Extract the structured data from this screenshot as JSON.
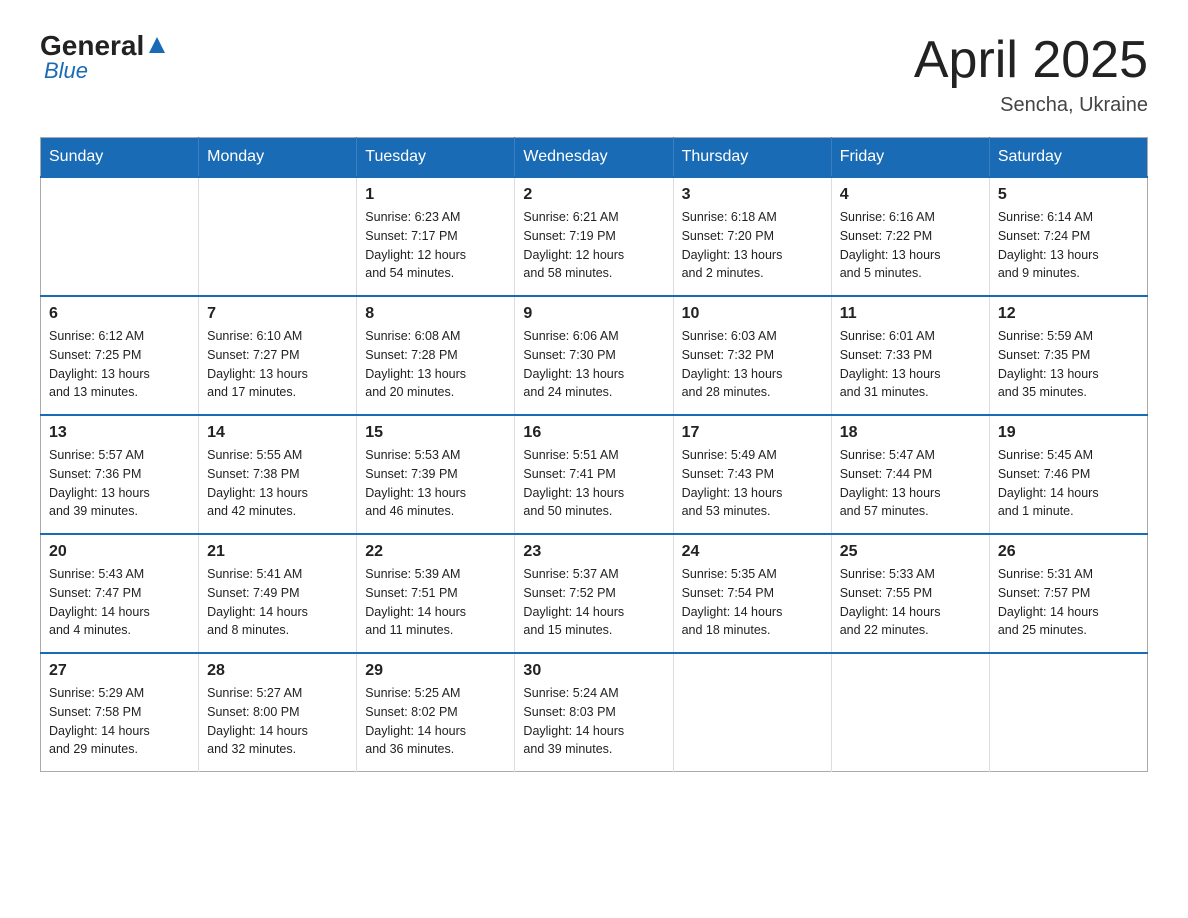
{
  "header": {
    "logo_general": "General",
    "logo_blue": "Blue",
    "title": "April 2025",
    "subtitle": "Sencha, Ukraine"
  },
  "days_of_week": [
    "Sunday",
    "Monday",
    "Tuesday",
    "Wednesday",
    "Thursday",
    "Friday",
    "Saturday"
  ],
  "weeks": [
    [
      {
        "day": "",
        "info": ""
      },
      {
        "day": "",
        "info": ""
      },
      {
        "day": "1",
        "info": "Sunrise: 6:23 AM\nSunset: 7:17 PM\nDaylight: 12 hours\nand 54 minutes."
      },
      {
        "day": "2",
        "info": "Sunrise: 6:21 AM\nSunset: 7:19 PM\nDaylight: 12 hours\nand 58 minutes."
      },
      {
        "day": "3",
        "info": "Sunrise: 6:18 AM\nSunset: 7:20 PM\nDaylight: 13 hours\nand 2 minutes."
      },
      {
        "day": "4",
        "info": "Sunrise: 6:16 AM\nSunset: 7:22 PM\nDaylight: 13 hours\nand 5 minutes."
      },
      {
        "day": "5",
        "info": "Sunrise: 6:14 AM\nSunset: 7:24 PM\nDaylight: 13 hours\nand 9 minutes."
      }
    ],
    [
      {
        "day": "6",
        "info": "Sunrise: 6:12 AM\nSunset: 7:25 PM\nDaylight: 13 hours\nand 13 minutes."
      },
      {
        "day": "7",
        "info": "Sunrise: 6:10 AM\nSunset: 7:27 PM\nDaylight: 13 hours\nand 17 minutes."
      },
      {
        "day": "8",
        "info": "Sunrise: 6:08 AM\nSunset: 7:28 PM\nDaylight: 13 hours\nand 20 minutes."
      },
      {
        "day": "9",
        "info": "Sunrise: 6:06 AM\nSunset: 7:30 PM\nDaylight: 13 hours\nand 24 minutes."
      },
      {
        "day": "10",
        "info": "Sunrise: 6:03 AM\nSunset: 7:32 PM\nDaylight: 13 hours\nand 28 minutes."
      },
      {
        "day": "11",
        "info": "Sunrise: 6:01 AM\nSunset: 7:33 PM\nDaylight: 13 hours\nand 31 minutes."
      },
      {
        "day": "12",
        "info": "Sunrise: 5:59 AM\nSunset: 7:35 PM\nDaylight: 13 hours\nand 35 minutes."
      }
    ],
    [
      {
        "day": "13",
        "info": "Sunrise: 5:57 AM\nSunset: 7:36 PM\nDaylight: 13 hours\nand 39 minutes."
      },
      {
        "day": "14",
        "info": "Sunrise: 5:55 AM\nSunset: 7:38 PM\nDaylight: 13 hours\nand 42 minutes."
      },
      {
        "day": "15",
        "info": "Sunrise: 5:53 AM\nSunset: 7:39 PM\nDaylight: 13 hours\nand 46 minutes."
      },
      {
        "day": "16",
        "info": "Sunrise: 5:51 AM\nSunset: 7:41 PM\nDaylight: 13 hours\nand 50 minutes."
      },
      {
        "day": "17",
        "info": "Sunrise: 5:49 AM\nSunset: 7:43 PM\nDaylight: 13 hours\nand 53 minutes."
      },
      {
        "day": "18",
        "info": "Sunrise: 5:47 AM\nSunset: 7:44 PM\nDaylight: 13 hours\nand 57 minutes."
      },
      {
        "day": "19",
        "info": "Sunrise: 5:45 AM\nSunset: 7:46 PM\nDaylight: 14 hours\nand 1 minute."
      }
    ],
    [
      {
        "day": "20",
        "info": "Sunrise: 5:43 AM\nSunset: 7:47 PM\nDaylight: 14 hours\nand 4 minutes."
      },
      {
        "day": "21",
        "info": "Sunrise: 5:41 AM\nSunset: 7:49 PM\nDaylight: 14 hours\nand 8 minutes."
      },
      {
        "day": "22",
        "info": "Sunrise: 5:39 AM\nSunset: 7:51 PM\nDaylight: 14 hours\nand 11 minutes."
      },
      {
        "day": "23",
        "info": "Sunrise: 5:37 AM\nSunset: 7:52 PM\nDaylight: 14 hours\nand 15 minutes."
      },
      {
        "day": "24",
        "info": "Sunrise: 5:35 AM\nSunset: 7:54 PM\nDaylight: 14 hours\nand 18 minutes."
      },
      {
        "day": "25",
        "info": "Sunrise: 5:33 AM\nSunset: 7:55 PM\nDaylight: 14 hours\nand 22 minutes."
      },
      {
        "day": "26",
        "info": "Sunrise: 5:31 AM\nSunset: 7:57 PM\nDaylight: 14 hours\nand 25 minutes."
      }
    ],
    [
      {
        "day": "27",
        "info": "Sunrise: 5:29 AM\nSunset: 7:58 PM\nDaylight: 14 hours\nand 29 minutes."
      },
      {
        "day": "28",
        "info": "Sunrise: 5:27 AM\nSunset: 8:00 PM\nDaylight: 14 hours\nand 32 minutes."
      },
      {
        "day": "29",
        "info": "Sunrise: 5:25 AM\nSunset: 8:02 PM\nDaylight: 14 hours\nand 36 minutes."
      },
      {
        "day": "30",
        "info": "Sunrise: 5:24 AM\nSunset: 8:03 PM\nDaylight: 14 hours\nand 39 minutes."
      },
      {
        "day": "",
        "info": ""
      },
      {
        "day": "",
        "info": ""
      },
      {
        "day": "",
        "info": ""
      }
    ]
  ]
}
